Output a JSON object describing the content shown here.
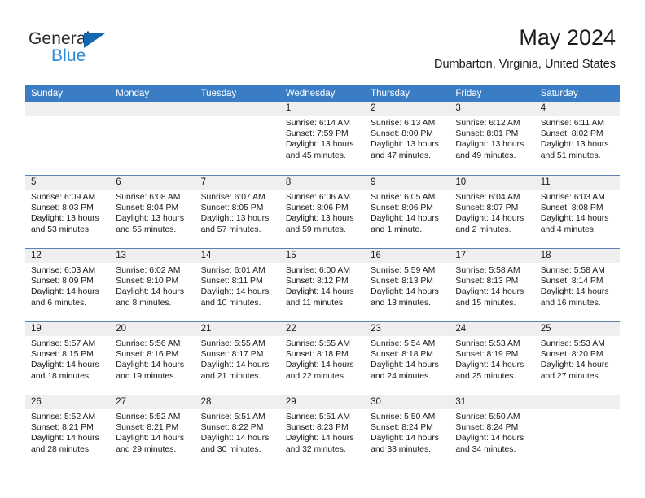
{
  "logo": {
    "word_top": "General",
    "word_bottom": "Blue",
    "color_dark": "#2b2b2b",
    "color_blue": "#2e8ad8",
    "triangle_color": "#1667b2"
  },
  "header": {
    "title": "May 2024",
    "subtitle": "Dumbarton, Virginia, United States"
  },
  "theme": {
    "header_row_bg": "#3b7dc4",
    "header_row_text": "#ffffff",
    "day_band_bg": "#efefef",
    "row_divider": "#5c83ad",
    "text": "#1a1a1a"
  },
  "calendar": {
    "weekdays": [
      "Sunday",
      "Monday",
      "Tuesday",
      "Wednesday",
      "Thursday",
      "Friday",
      "Saturday"
    ],
    "weeks": [
      [
        {
          "day": "",
          "empty": true
        },
        {
          "day": "",
          "empty": true
        },
        {
          "day": "",
          "empty": true
        },
        {
          "day": "1",
          "sunrise": "Sunrise: 6:14 AM",
          "sunset": "Sunset: 7:59 PM",
          "daylight_1": "Daylight: 13 hours",
          "daylight_2": "and 45 minutes."
        },
        {
          "day": "2",
          "sunrise": "Sunrise: 6:13 AM",
          "sunset": "Sunset: 8:00 PM",
          "daylight_1": "Daylight: 13 hours",
          "daylight_2": "and 47 minutes."
        },
        {
          "day": "3",
          "sunrise": "Sunrise: 6:12 AM",
          "sunset": "Sunset: 8:01 PM",
          "daylight_1": "Daylight: 13 hours",
          "daylight_2": "and 49 minutes."
        },
        {
          "day": "4",
          "sunrise": "Sunrise: 6:11 AM",
          "sunset": "Sunset: 8:02 PM",
          "daylight_1": "Daylight: 13 hours",
          "daylight_2": "and 51 minutes."
        }
      ],
      [
        {
          "day": "5",
          "sunrise": "Sunrise: 6:09 AM",
          "sunset": "Sunset: 8:03 PM",
          "daylight_1": "Daylight: 13 hours",
          "daylight_2": "and 53 minutes."
        },
        {
          "day": "6",
          "sunrise": "Sunrise: 6:08 AM",
          "sunset": "Sunset: 8:04 PM",
          "daylight_1": "Daylight: 13 hours",
          "daylight_2": "and 55 minutes."
        },
        {
          "day": "7",
          "sunrise": "Sunrise: 6:07 AM",
          "sunset": "Sunset: 8:05 PM",
          "daylight_1": "Daylight: 13 hours",
          "daylight_2": "and 57 minutes."
        },
        {
          "day": "8",
          "sunrise": "Sunrise: 6:06 AM",
          "sunset": "Sunset: 8:06 PM",
          "daylight_1": "Daylight: 13 hours",
          "daylight_2": "and 59 minutes."
        },
        {
          "day": "9",
          "sunrise": "Sunrise: 6:05 AM",
          "sunset": "Sunset: 8:06 PM",
          "daylight_1": "Daylight: 14 hours",
          "daylight_2": "and 1 minute."
        },
        {
          "day": "10",
          "sunrise": "Sunrise: 6:04 AM",
          "sunset": "Sunset: 8:07 PM",
          "daylight_1": "Daylight: 14 hours",
          "daylight_2": "and 2 minutes."
        },
        {
          "day": "11",
          "sunrise": "Sunrise: 6:03 AM",
          "sunset": "Sunset: 8:08 PM",
          "daylight_1": "Daylight: 14 hours",
          "daylight_2": "and 4 minutes."
        }
      ],
      [
        {
          "day": "12",
          "sunrise": "Sunrise: 6:03 AM",
          "sunset": "Sunset: 8:09 PM",
          "daylight_1": "Daylight: 14 hours",
          "daylight_2": "and 6 minutes."
        },
        {
          "day": "13",
          "sunrise": "Sunrise: 6:02 AM",
          "sunset": "Sunset: 8:10 PM",
          "daylight_1": "Daylight: 14 hours",
          "daylight_2": "and 8 minutes."
        },
        {
          "day": "14",
          "sunrise": "Sunrise: 6:01 AM",
          "sunset": "Sunset: 8:11 PM",
          "daylight_1": "Daylight: 14 hours",
          "daylight_2": "and 10 minutes."
        },
        {
          "day": "15",
          "sunrise": "Sunrise: 6:00 AM",
          "sunset": "Sunset: 8:12 PM",
          "daylight_1": "Daylight: 14 hours",
          "daylight_2": "and 11 minutes."
        },
        {
          "day": "16",
          "sunrise": "Sunrise: 5:59 AM",
          "sunset": "Sunset: 8:13 PM",
          "daylight_1": "Daylight: 14 hours",
          "daylight_2": "and 13 minutes."
        },
        {
          "day": "17",
          "sunrise": "Sunrise: 5:58 AM",
          "sunset": "Sunset: 8:13 PM",
          "daylight_1": "Daylight: 14 hours",
          "daylight_2": "and 15 minutes."
        },
        {
          "day": "18",
          "sunrise": "Sunrise: 5:58 AM",
          "sunset": "Sunset: 8:14 PM",
          "daylight_1": "Daylight: 14 hours",
          "daylight_2": "and 16 minutes."
        }
      ],
      [
        {
          "day": "19",
          "sunrise": "Sunrise: 5:57 AM",
          "sunset": "Sunset: 8:15 PM",
          "daylight_1": "Daylight: 14 hours",
          "daylight_2": "and 18 minutes."
        },
        {
          "day": "20",
          "sunrise": "Sunrise: 5:56 AM",
          "sunset": "Sunset: 8:16 PM",
          "daylight_1": "Daylight: 14 hours",
          "daylight_2": "and 19 minutes."
        },
        {
          "day": "21",
          "sunrise": "Sunrise: 5:55 AM",
          "sunset": "Sunset: 8:17 PM",
          "daylight_1": "Daylight: 14 hours",
          "daylight_2": "and 21 minutes."
        },
        {
          "day": "22",
          "sunrise": "Sunrise: 5:55 AM",
          "sunset": "Sunset: 8:18 PM",
          "daylight_1": "Daylight: 14 hours",
          "daylight_2": "and 22 minutes."
        },
        {
          "day": "23",
          "sunrise": "Sunrise: 5:54 AM",
          "sunset": "Sunset: 8:18 PM",
          "daylight_1": "Daylight: 14 hours",
          "daylight_2": "and 24 minutes."
        },
        {
          "day": "24",
          "sunrise": "Sunrise: 5:53 AM",
          "sunset": "Sunset: 8:19 PM",
          "daylight_1": "Daylight: 14 hours",
          "daylight_2": "and 25 minutes."
        },
        {
          "day": "25",
          "sunrise": "Sunrise: 5:53 AM",
          "sunset": "Sunset: 8:20 PM",
          "daylight_1": "Daylight: 14 hours",
          "daylight_2": "and 27 minutes."
        }
      ],
      [
        {
          "day": "26",
          "sunrise": "Sunrise: 5:52 AM",
          "sunset": "Sunset: 8:21 PM",
          "daylight_1": "Daylight: 14 hours",
          "daylight_2": "and 28 minutes."
        },
        {
          "day": "27",
          "sunrise": "Sunrise: 5:52 AM",
          "sunset": "Sunset: 8:21 PM",
          "daylight_1": "Daylight: 14 hours",
          "daylight_2": "and 29 minutes."
        },
        {
          "day": "28",
          "sunrise": "Sunrise: 5:51 AM",
          "sunset": "Sunset: 8:22 PM",
          "daylight_1": "Daylight: 14 hours",
          "daylight_2": "and 30 minutes."
        },
        {
          "day": "29",
          "sunrise": "Sunrise: 5:51 AM",
          "sunset": "Sunset: 8:23 PM",
          "daylight_1": "Daylight: 14 hours",
          "daylight_2": "and 32 minutes."
        },
        {
          "day": "30",
          "sunrise": "Sunrise: 5:50 AM",
          "sunset": "Sunset: 8:24 PM",
          "daylight_1": "Daylight: 14 hours",
          "daylight_2": "and 33 minutes."
        },
        {
          "day": "31",
          "sunrise": "Sunrise: 5:50 AM",
          "sunset": "Sunset: 8:24 PM",
          "daylight_1": "Daylight: 14 hours",
          "daylight_2": "and 34 minutes."
        },
        {
          "day": "",
          "empty": true
        }
      ]
    ]
  }
}
